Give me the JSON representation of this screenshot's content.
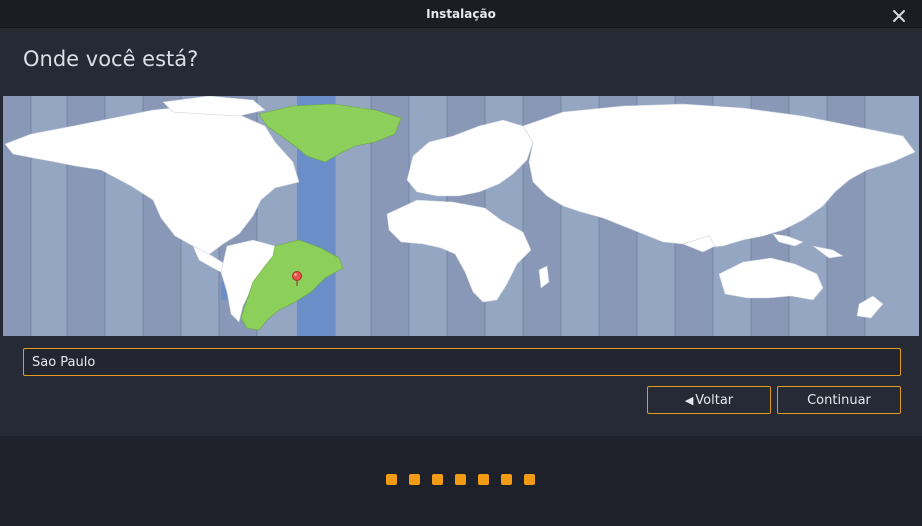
{
  "window": {
    "title": "Instalação",
    "close_icon": "close-icon"
  },
  "page": {
    "heading": "Onde você está?"
  },
  "map": {
    "highlight_color": "#8ccf5a",
    "ocean_color": "#95a6c2",
    "selected_zone_color": "#6b8ec9",
    "pin_icon": "location-pin-icon"
  },
  "location_input": {
    "value": "Sao Paulo"
  },
  "buttons": {
    "back_label": "Voltar",
    "back_icon": "arrow-left-icon",
    "continue_label": "Continuar",
    "accent": "#e29a1f"
  },
  "progress": {
    "total_steps": 7,
    "color": "#f29b14"
  }
}
